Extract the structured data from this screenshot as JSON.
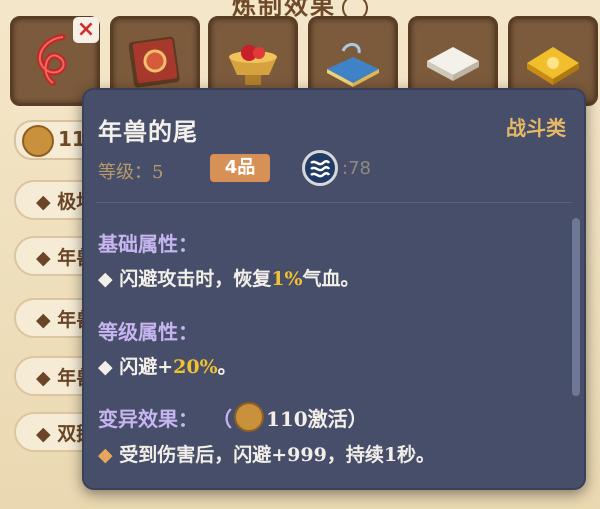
{
  "background": {
    "title": "炼制效果",
    "coin_value": "11",
    "list_items": [
      "◆ 极地",
      "◆ 年兽",
      "◆ 年兽",
      "◆ 年兽",
      "◆ 双鹅"
    ]
  },
  "tooltip": {
    "name": "年兽的尾",
    "category": "战斗类",
    "level_label": "等级：5",
    "grade": "4品",
    "element_value": ":78",
    "sections": {
      "base": {
        "title": "基础属性：",
        "line_prefix": "◆ 闪避攻击时，恢复",
        "line_highlight": "1%",
        "line_suffix": "气血。"
      },
      "level": {
        "title": "等级属性：",
        "line_prefix": "◆ 闪避+",
        "line_highlight": "20%",
        "line_suffix": "。"
      },
      "mutation": {
        "title": "变异效果：",
        "activate_open": "（",
        "activate_text": "110激活）",
        "line_diamond": "◆",
        "line_text": " 受到伤害后，闪避+999，持续1秒。"
      }
    }
  },
  "colors": {
    "tooltip_bg": "#474e69",
    "highlight": "#f2c132",
    "section_title": "#c6b5ef",
    "category": "#e6b866",
    "grade_badge": "#d79055"
  },
  "icons": [
    "close-icon",
    "red-rope-item-icon",
    "red-book-item-icon",
    "red-bowl-item-icon",
    "blue-book-item-icon",
    "white-box-item-icon",
    "gold-tile-item-icon",
    "coin-icon",
    "water-element-icon"
  ]
}
